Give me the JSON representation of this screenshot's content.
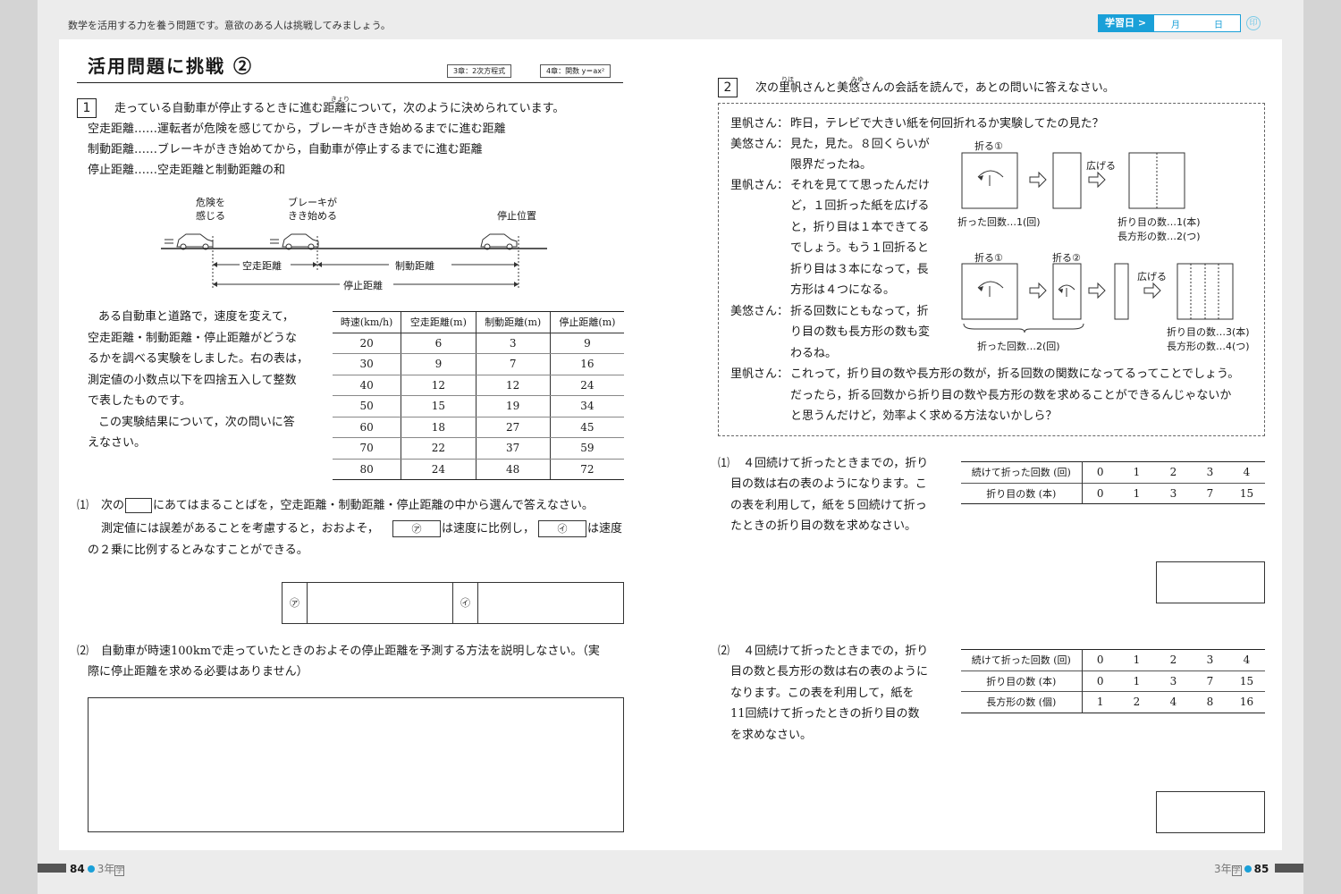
{
  "header": {
    "note": "数学を活用する力を養う問題です。意欲のある人は挑戦してみましょう。",
    "study_day_label": "学習日 >",
    "month": "月",
    "day": "日",
    "check": "ｻｲﾝ"
  },
  "title": "活用問題に挑戦 ②",
  "tags": [
    "3章：2次方程式",
    "4章：関数 y＝ax²"
  ],
  "q1": {
    "num": "1",
    "intro": "走っている自動車が停止するときに進む距離について，次のように決められています。",
    "ruby_kyori": "きょり",
    "defs": [
      "空走距離……運転者が危険を感じてから，ブレーキがきき始めるまでに進む距離",
      "制動距離……ブレーキがきき始めてから，自動車が停止するまでに進む距離",
      "停止距離……空走距離と制動距離の和"
    ],
    "diagram": {
      "danger": [
        "危険を",
        "感じる"
      ],
      "brake": [
        "ブレーキが",
        "きき始める"
      ],
      "stop": "停止位置",
      "kuso": "空走距離",
      "seido": "制動距離",
      "teishi": "停止距離"
    },
    "para": [
      "ある自動車と道路で，速度を変えて，",
      "空走距離・制動距離・停止距離がどうな",
      "るかを調べる実験をしました。右の表は，",
      "測定値の小数点以下を四捨五入して整数",
      "で表したものです。",
      "この実験結果について，次の問いに答",
      "えなさい。"
    ],
    "table": {
      "headers": [
        "時速(km/h)",
        "空走距離(m)",
        "制動距離(m)",
        "停止距離(m)"
      ],
      "rows": [
        [
          "20",
          "6",
          "3",
          "9"
        ],
        [
          "30",
          "9",
          "7",
          "16"
        ],
        [
          "40",
          "12",
          "12",
          "24"
        ],
        [
          "50",
          "15",
          "19",
          "34"
        ],
        [
          "60",
          "18",
          "27",
          "45"
        ],
        [
          "70",
          "22",
          "37",
          "59"
        ],
        [
          "80",
          "24",
          "48",
          "72"
        ]
      ]
    },
    "sub1": {
      "label": "⑴",
      "line1a": "次の",
      "line1b": "にあてはまることばを，空走距離・制動距離・停止距離の中から選んで答えなさい。",
      "line2a": "測定値には誤差があることを考慮すると，おおよそ，",
      "blank_a": "㋐",
      "line2b": "は速度に比例し，",
      "blank_b": "㋑",
      "line2c": "は速度",
      "line3": "の２乗に比例するとみなすことができる。",
      "ans_a": "㋐",
      "ans_b": "㋑"
    },
    "sub2": {
      "label": "⑵",
      "line1": "自動車が時速100kmで走っていたときのおよその停止距離を予測する方法を説明しなさい。（実",
      "line2": "際に停止距離を求める必要はありません）"
    }
  },
  "q2": {
    "num": "2",
    "intro_a": "次の",
    "name1": "里帆",
    "ruby1": "りほ",
    "intro_b": "さんと",
    "name2": "美悠",
    "ruby2": "みゆ",
    "intro_c": "さんの会話を読んで，あとの問いに答えなさい。",
    "dialogue": [
      {
        "speaker": "里帆さん：",
        "lines": [
          "昨日，テレビで大きい紙を何回折れるか実験してたの見た？"
        ]
      },
      {
        "speaker": "美悠さん：",
        "lines": [
          "見た，見た。８回くらいが",
          "限界だったね。"
        ]
      },
      {
        "speaker": "里帆さん：",
        "lines": [
          "それを見てて思ったんだけ",
          "ど，１回折った紙を広げる",
          "と，折り目は１本できてる",
          "でしょう。もう１回折ると",
          "折り目は３本になって，長",
          "方形は４つになる。"
        ]
      },
      {
        "speaker": "美悠さん：",
        "lines": [
          "折る回数にともなって，折",
          "り目の数も長方形の数も変",
          "わるね。"
        ]
      },
      {
        "speaker": "里帆さん：",
        "lines": [
          "これって，折り目の数や長方形の数が，折る回数の関数になってるってことでしょう。",
          "だったら，折る回数から折り目の数や長方形の数を求めることができるんじゃないか",
          "と思うんだけど，効率よく求める方法ないかしら？"
        ]
      }
    ],
    "fig": {
      "fold1": "折る①",
      "fold2": "折る②",
      "open": "広げる",
      "count1": "折った回数…1(回)",
      "result1a": "折り目の数…1(本)",
      "result1b": "長方形の数…2(つ)",
      "count2": "折った回数…2(回)",
      "result2a": "折り目の数…3(本)",
      "result2b": "長方形の数…4(つ)"
    },
    "sub1": {
      "label": "⑴",
      "lines": [
        "４回続けて折ったときまでの，折り",
        "目の数は右の表のようになります。こ",
        "の表を利用して，紙を５回続けて折っ",
        "たときの折り目の数を求めなさい。"
      ],
      "table": {
        "rows": [
          {
            "head": "続けて折った回数 (回)",
            "vals": [
              "0",
              "1",
              "2",
              "3",
              "4"
            ]
          },
          {
            "head": "折り目の数 (本)",
            "vals": [
              "0",
              "1",
              "3",
              "7",
              "15"
            ]
          }
        ]
      }
    },
    "sub2": {
      "label": "⑵",
      "lines": [
        "４回続けて折ったときまでの，折り",
        "目の数と長方形の数は右の表のように",
        "なります。この表を利用して，紙を",
        "11回続けて折ったときの折り目の数",
        "を求めなさい。"
      ],
      "table": {
        "rows": [
          {
            "head": "続けて折った回数 (回)",
            "vals": [
              "0",
              "1",
              "2",
              "3",
              "4"
            ]
          },
          {
            "head": "折り目の数 (本)",
            "vals": [
              "0",
              "1",
              "3",
              "7",
              "15"
            ]
          },
          {
            "head": "長方形の数 (個)",
            "vals": [
              "1",
              "2",
              "4",
              "8",
              "16"
            ]
          }
        ]
      }
    }
  },
  "footer": {
    "left_page": "84",
    "left_grade": "3年",
    "left_subject": "学",
    "right_grade": "3年",
    "right_subject": "学",
    "right_page": "85"
  }
}
